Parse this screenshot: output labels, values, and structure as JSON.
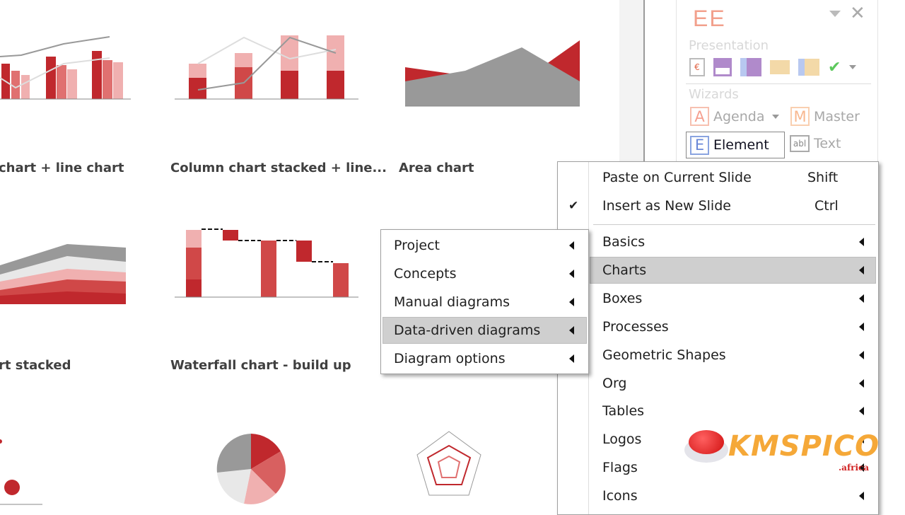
{
  "gallery": {
    "captions": [
      "chart + line chart",
      "Column chart stacked + line...",
      "Area chart",
      "rt stacked",
      "Waterfall chart - build up"
    ],
    "thumbnails": [
      "column-line-chart",
      "column-stacked-line-chart",
      "area-chart",
      "area-stacked-chart",
      "waterfall-chart",
      "bubble-chart",
      "pie-chart",
      "radar-chart"
    ]
  },
  "panel": {
    "logo": "EE",
    "presentation_label": "Presentation",
    "wizards_label": "Wizards",
    "wizards": [
      {
        "icon": "A",
        "label": "Agenda"
      },
      {
        "icon": "M",
        "label": "Master"
      },
      {
        "icon": "E",
        "label": "Element"
      },
      {
        "icon": "abl",
        "label": "Text"
      }
    ]
  },
  "main_menu": {
    "paste": {
      "label": "Paste on Current Slide",
      "shortcut": "Shift"
    },
    "insert": {
      "label": "Insert as New Slide",
      "shortcut": "Ctrl",
      "checked": true
    },
    "items": [
      "Basics",
      "Charts",
      "Boxes",
      "Processes",
      "Geometric Shapes",
      "Org",
      "Tables",
      "Logos",
      "Flags",
      "Icons"
    ],
    "highlighted": "Charts"
  },
  "sub_menu": {
    "items": [
      "Project",
      "Concepts",
      "Manual diagrams",
      "Data-driven diagrams",
      "Diagram options"
    ],
    "highlighted": "Data-driven diagrams"
  },
  "watermark": {
    "text": "KMSPICO",
    "suffix": ".africa"
  },
  "colors": {
    "accent_red": "#c0282d",
    "highlight": "#cfcfcf"
  }
}
